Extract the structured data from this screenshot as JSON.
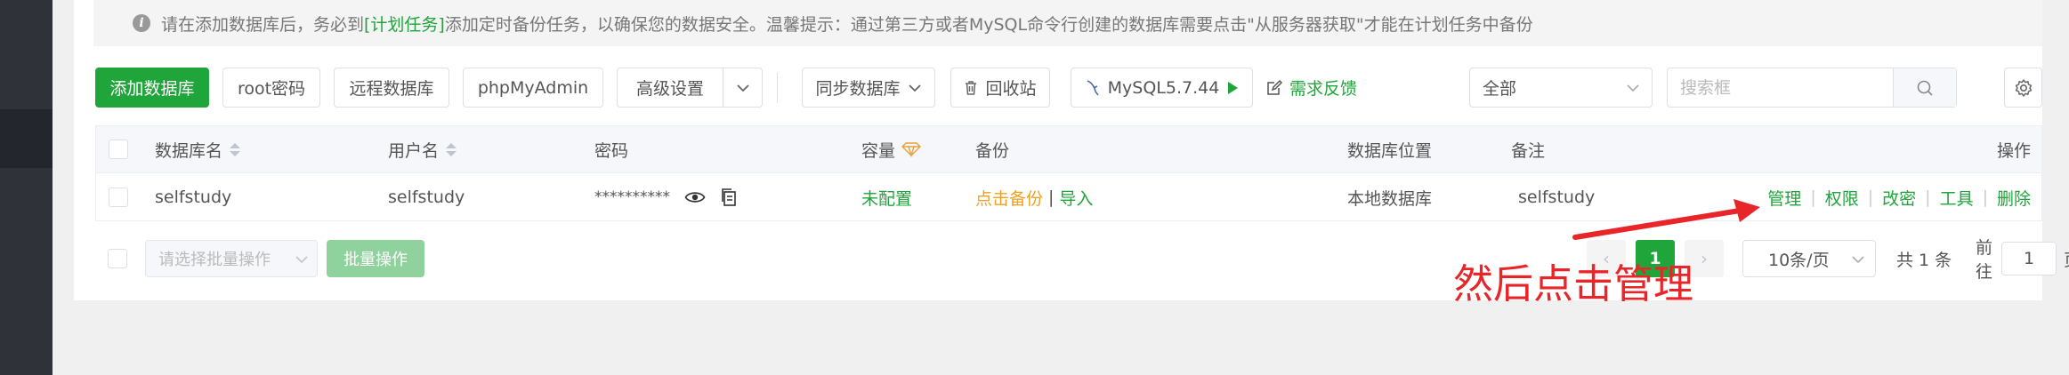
{
  "notice": {
    "prefix": "请在添加数据库后，务必到",
    "link": "[计划任务]",
    "suffix": "添加定时备份任务，以确保您的数据安全。温馨提示：通过第三方或者MySQL命令行创建的数据库需要点击\"从服务器获取\"才能在计划任务中备份"
  },
  "toolbar": {
    "add_db": "添加数据库",
    "root_pwd": "root密码",
    "remote_db": "远程数据库",
    "phpmyadmin": "phpMyAdmin",
    "advanced": "高级设置",
    "sync_db": "同步数据库",
    "recycle": "回收站",
    "mysql_version": "MySQL5.7.44",
    "feedback": "需求反馈",
    "filter_selected": "全部",
    "search_placeholder": "搜索框"
  },
  "table": {
    "headers": {
      "name": "数据库名",
      "user": "用户名",
      "password": "密码",
      "capacity": "容量",
      "backup": "备份",
      "location": "数据库位置",
      "note": "备注",
      "ops": "操作"
    },
    "rows": [
      {
        "name": "selfstudy",
        "user": "selfstudy",
        "password": "**********",
        "capacity": "未配置",
        "backup_action": "点击备份",
        "backup_sep": "|",
        "import_action": "导入",
        "location": "本地数据库",
        "note": "selfstudy",
        "ops": [
          "管理",
          "权限",
          "改密",
          "工具",
          "删除"
        ]
      }
    ]
  },
  "footer": {
    "batch_placeholder": "请选择批量操作",
    "batch_button": "批量操作",
    "prev": "‹",
    "next": "›",
    "current_page": "1",
    "page_size": "10条/页",
    "total": "共 1 条",
    "goto_label": "前往",
    "goto_value": "1",
    "page_unit": "页"
  },
  "annotation": {
    "text": "然后点击管理"
  },
  "colors": {
    "accent": "#20a53a",
    "warning": "#f0a020",
    "annotation": "#e8262a",
    "sidebar": "#30323a"
  }
}
